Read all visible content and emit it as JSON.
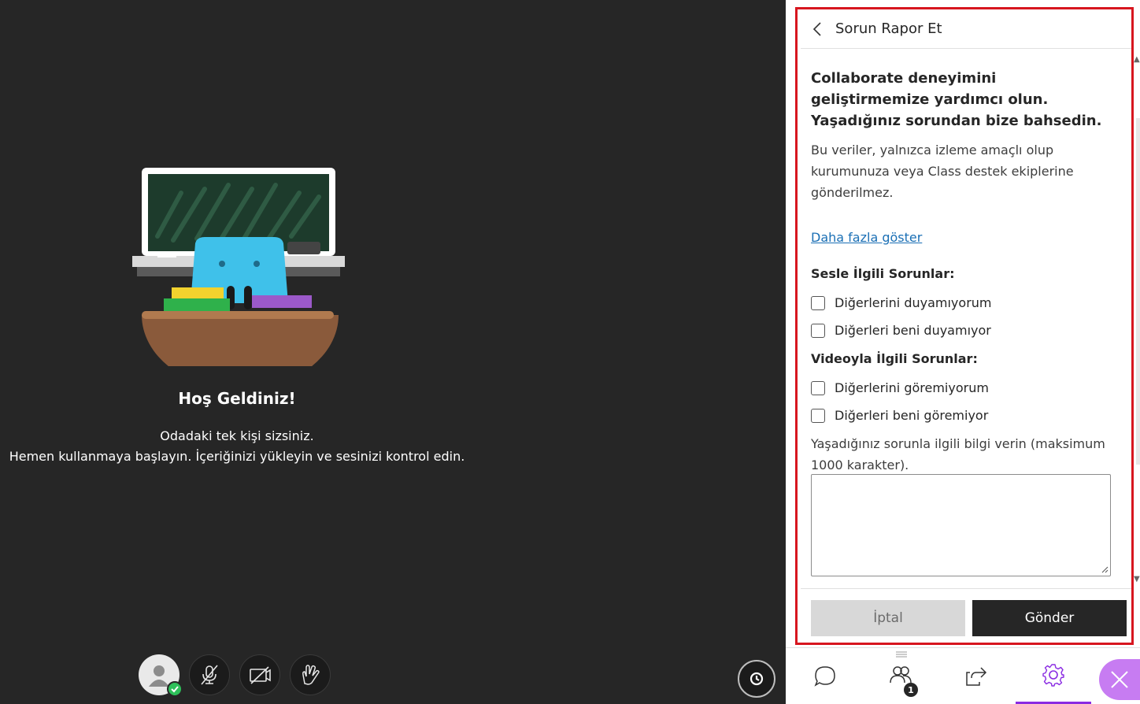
{
  "main": {
    "welcome_title": "Hoş Geldiniz!",
    "welcome_line1": "Odadaki tek kişi sizsiniz.",
    "welcome_line2": "Hemen kullanmaya başlayın. İçeriğinizi yükleyin ve sesinizi kontrol edin.",
    "controls": [
      "avatar",
      "microphone-off-icon",
      "camera-off-icon",
      "raise-hand-icon"
    ]
  },
  "panel": {
    "title": "Sorun Rapor Et",
    "intro": "Collaborate deneyimini geliştirmemize yardımcı olun. Yaşadığınız sorundan bize bahsedin.",
    "note": "Bu veriler, yalnızca izleme amaçlı olup kurumunuza veya Class destek ekiplerine gönderilmez.",
    "more_link": "Daha fazla göster",
    "audio_section": "Sesle İlgili Sorunlar:",
    "audio_options": [
      "Diğerlerini duyamıyorum",
      "Diğerleri beni duyamıyor"
    ],
    "video_section": "Videoyla İlgili Sorunlar:",
    "video_options": [
      "Diğerlerini göremiyorum",
      "Diğerleri beni göremiyor"
    ],
    "details_label": "Yaşadığınız sorunla ilgili bilgi verin (maksimum 1000 karakter).",
    "details_value": "",
    "cancel_label": "İptal",
    "send_label": "Gönder"
  },
  "bottom_nav": {
    "people_count": "1",
    "active": "settings"
  },
  "colors": {
    "accent": "#8a2be2",
    "close_bg": "#c77cf2",
    "highlight_frame": "#d7161f",
    "link": "#1a6fb5"
  }
}
